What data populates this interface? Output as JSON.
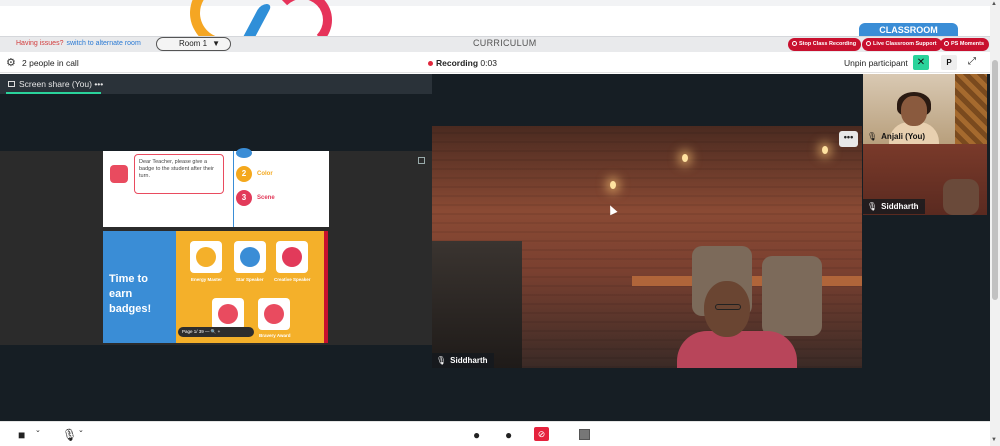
{
  "header": {
    "classroom_tab": "CLASSROOM",
    "issues_text": "Having issues?",
    "issues_link": "switch to alternate room",
    "room": "Room 1",
    "curriculum": "CURRICULUM",
    "actions": [
      {
        "label": "Stop Class Recording"
      },
      {
        "label": "Live Classroom Support"
      },
      {
        "label": "PS Moments"
      }
    ]
  },
  "call": {
    "people_count": "2 people in call",
    "recording_label": "Recording",
    "recording_time": "0:03",
    "unpin_label": "Unpin participant",
    "p_button": "P",
    "close_glyph": "✕"
  },
  "screen_share": {
    "title": "Screen share (You)",
    "menu": "•••",
    "slide": {
      "bubble_text": "Dear Teacher, please give a badge to the student after their turn.",
      "steps": [
        {
          "num": "2",
          "label": "Color",
          "color": "#f4a81d"
        },
        {
          "num": "3",
          "label": "Scene",
          "color": "#e23a5a"
        }
      ],
      "earn_text": "Time to earn badges!",
      "badges": [
        "Energy Master",
        "Star Speaker",
        "Creative Speaker",
        "Bravery Award"
      ],
      "pager": "Page  1/  39   —  🔍  +"
    }
  },
  "participants": {
    "main": {
      "name": "Siddharth",
      "menu": "•••"
    },
    "thumbs": [
      {
        "name": "Anjali (You)"
      },
      {
        "name": "Siddharth"
      }
    ]
  },
  "colors": {
    "accent_green": "#2ad39b",
    "danger_red": "#c8102e",
    "brand_blue": "#3a8dd6"
  }
}
